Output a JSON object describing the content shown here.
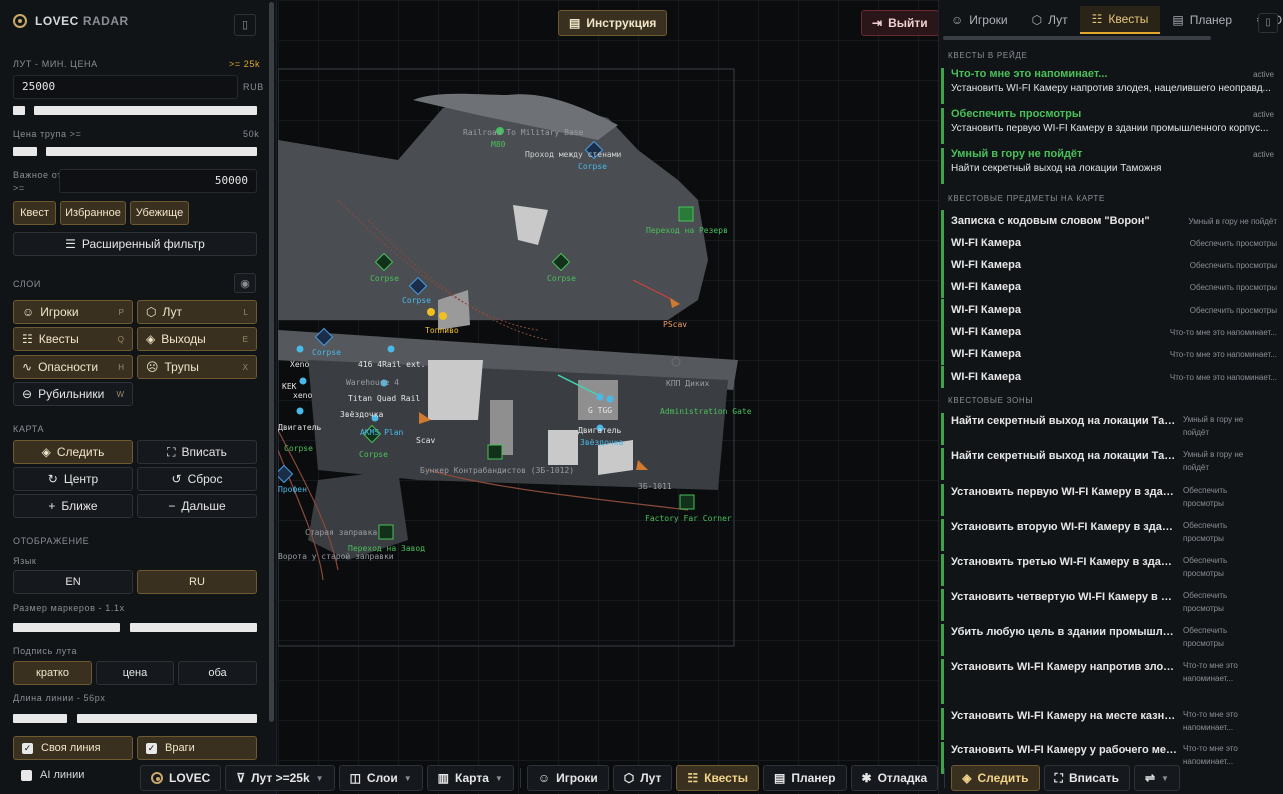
{
  "brand": {
    "name": "LOVEC",
    "suffix": "RADAR"
  },
  "loot": {
    "section": "Лут - мин. цена",
    "badge": ">= 25k",
    "value": "25000",
    "unit": "RUB",
    "corpse_label": "Цена трупа >=",
    "corpse_value": "50k",
    "important_label1": "Важное от",
    "important_label2": ">=",
    "important_value": "50000",
    "filters": [
      "Квест",
      "Избранное",
      "Убежище"
    ],
    "advanced": "Расширенный фильтр"
  },
  "layers": {
    "section": "Слои",
    "items": [
      {
        "label": "Игроки",
        "key": "P"
      },
      {
        "label": "Лут",
        "key": "L"
      },
      {
        "label": "Квесты",
        "key": "Q"
      },
      {
        "label": "Выходы",
        "key": "E"
      },
      {
        "label": "Опасности",
        "key": "H"
      },
      {
        "label": "Трупы",
        "key": "X"
      },
      {
        "label": "Рубильники",
        "key": "W"
      }
    ]
  },
  "map_ctrl": {
    "section": "Карта",
    "follow": "Следить",
    "fit": "Вписать",
    "center": "Центр",
    "reset": "Сброс",
    "closer": "Ближе",
    "farther": "Дальше"
  },
  "display": {
    "section": "Отображение",
    "lang_label": "Язык",
    "lang_en": "EN",
    "lang_ru": "RU",
    "marker_size": "Размер маркеров - 1.1x",
    "loot_caption": "Подпись лута",
    "cap_short": "кратко",
    "cap_price": "цена",
    "cap_both": "оба",
    "line_len": "Длина линии - 56px",
    "own_line": "Своя линия",
    "enemies": "Враги",
    "ai_lines": "AI линии"
  },
  "top": {
    "instructions": "Инструкция",
    "logout": "Выйти"
  },
  "tabs": [
    "Игроки",
    "Лут",
    "Квесты",
    "Планер",
    "О"
  ],
  "raid_quests": {
    "section": "Квесты в рейде",
    "items": [
      {
        "title": "Что-то мне это напоминает...",
        "desc": "Установить WI-FI Камеру напротив злодея, нацелившего неоправд...",
        "status": "active"
      },
      {
        "title": "Обеспечить просмотры",
        "desc": "Установить первую WI-FI Камеру в здании промышленного корпус...",
        "status": "active"
      },
      {
        "title": "Умный в гору не пойдёт",
        "desc": "Найти секретный выход на локации Таможня",
        "status": "active"
      }
    ]
  },
  "quest_items": {
    "section": "Квестовые предметы на карте",
    "items": [
      {
        "name": "Записка с кодовым словом \"Ворон\"",
        "quest": "Умный в гору не пойдёт"
      },
      {
        "name": "WI-FI Камера",
        "quest": "Обеспечить просмотры"
      },
      {
        "name": "WI-FI Камера",
        "quest": "Обеспечить просмотры"
      },
      {
        "name": "WI-FI Камера",
        "quest": "Обеспечить просмотры"
      },
      {
        "name": "WI-FI Камера",
        "quest": "Обеспечить просмотры"
      },
      {
        "name": "WI-FI Камера",
        "quest": "Что-то мне это напоминает..."
      },
      {
        "name": "WI-FI Камера",
        "quest": "Что-то мне это напоминает..."
      },
      {
        "name": "WI-FI Камера",
        "quest": "Что-то мне это напоминает..."
      }
    ]
  },
  "quest_zones": {
    "section": "Квестовые зоны",
    "items": [
      {
        "name": "Найти секретный выход на локации Там...",
        "quest": "Умный в гору не пойдёт"
      },
      {
        "name": "Найти секретный выход на локации Там...",
        "quest": "Умный в гору не пойдёт"
      },
      {
        "name": "Установить первую WI-FI Камеру в здании пром...",
        "quest": "Обеспечить просмотры"
      },
      {
        "name": "Установить вторую WI-FI Камеру в здании промы...",
        "quest": "Обеспечить просмотры"
      },
      {
        "name": "Установить третью WI-FI Камеру в здании промы...",
        "quest": "Обеспечить просмотры"
      },
      {
        "name": "Установить четвертую WI-FI Камеру в здании про...",
        "quest": "Обеспечить просмотры"
      },
      {
        "name": "Убить любую цель в здании промышленного ко...",
        "quest": "Обеспечить просмотры"
      },
      {
        "name": "Установить WI-FI Камеру напротив злодея, нац...",
        "quest": "Что-то мне это напоминает..."
      },
      {
        "name": "Установить WI-FI Камеру на месте казни член...",
        "quest": "Что-то мне это напоминает..."
      },
      {
        "name": "Установить WI-FI Камеру у рабочего места ин...",
        "quest": "Что-то мне это напоминает..."
      }
    ]
  },
  "bottom": {
    "brand": "LOVEC",
    "loot": "Лут >=25k",
    "layers": "Слои",
    "map": "Карта",
    "players": "Игроки",
    "loot2": "Лут",
    "quests": "Квесты",
    "planner": "Планер",
    "debug": "Отладка",
    "follow": "Следить",
    "fit": "Вписать"
  },
  "map_labels": {
    "railroad": "Railroad To Military Base",
    "m80": "M80",
    "passage": "Проход между стенами",
    "reserve": "Переход на Резерв",
    "pscav": "PScav",
    "kpp": "КПП Диких",
    "admin": "Administration Gate",
    "bunker": "Бункер Контрабандистов (ЗБ-1012)",
    "zb": "ЗБ-1011",
    "factory": "Factory Far Corner",
    "old_gas": "Старая заправка",
    "to_factory": "Переход на Завод",
    "gates": "Ворота у старой заправки",
    "corpse": "Corpse",
    "fuel": "Топливо",
    "rail": "416 4Rail ext.",
    "warehouse": "Warehouse 4",
    "titan": "Titan Quad Rail",
    "akms": "AKMS Plan",
    "scav": "Scav",
    "xeno": "Xeno",
    "kek": "KEK",
    "xeno2": "xeno",
    "engine": "Двигатель",
    "star": "Звёздочка",
    "tgg": "G TGG",
    "profen": "Профен"
  }
}
